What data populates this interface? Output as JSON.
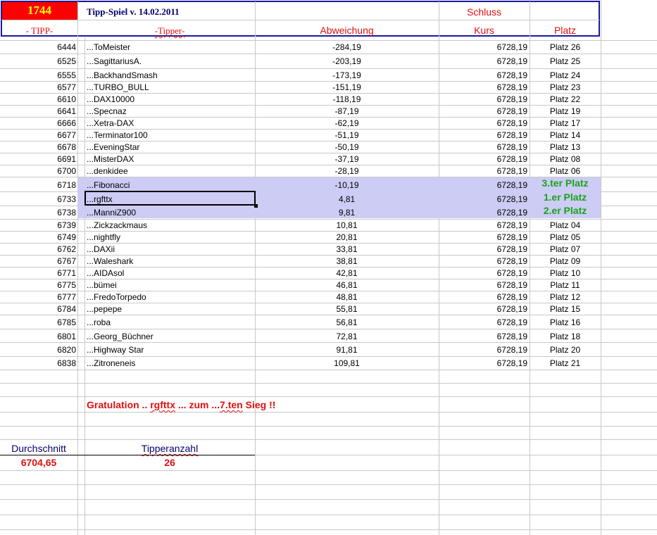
{
  "header": {
    "tipp_value": "1744",
    "title": "Tipp-Spiel v. 14.02.2011",
    "schluss": "Schluss",
    "col_tipp": "- TIPP-",
    "col_tipper": "-Tipper-",
    "col_abweichung": "Abweichung",
    "col_kurs": "Kurs",
    "col_platz": "Platz"
  },
  "rows": [
    {
      "tipp": "6444",
      "name": "...ToMeister",
      "abw": "-284,19",
      "kurs": "6728,19",
      "platz": "Platz 26"
    },
    {
      "tipp": "6525",
      "name": "...SagittariusA.",
      "abw": "-203,19",
      "kurs": "6728,19",
      "platz": "Platz 25"
    },
    {
      "tipp": "6555",
      "name": "...BackhandSmash",
      "abw": "-173,19",
      "kurs": "6728,19",
      "platz": "Platz 24"
    },
    {
      "tipp": "6577",
      "name": "...TURBO_BULL",
      "abw": "-151,19",
      "kurs": "6728,19",
      "platz": "Platz 23"
    },
    {
      "tipp": "6610",
      "name": "...DAX10000",
      "abw": "-118,19",
      "kurs": "6728,19",
      "platz": "Platz 22"
    },
    {
      "tipp": "6641",
      "name": "...Specnaz",
      "abw": "-87,19",
      "kurs": "6728,19",
      "platz": "Platz 19"
    },
    {
      "tipp": "6666",
      "name": "...Xetra-DAX",
      "abw": "-62,19",
      "kurs": "6728,19",
      "platz": "Platz 17"
    },
    {
      "tipp": "6677",
      "name": "...Terminator100",
      "abw": "-51,19",
      "kurs": "6728,19",
      "platz": "Platz 14"
    },
    {
      "tipp": "6678",
      "name": "...EveningStar",
      "abw": "-50,19",
      "kurs": "6728,19",
      "platz": "Platz 13"
    },
    {
      "tipp": "6691",
      "name": "...MisterDAX",
      "abw": "-37,19",
      "kurs": "6728,19",
      "platz": "Platz 08"
    },
    {
      "tipp": "6700",
      "name": "...denkidee",
      "abw": "-28,19",
      "kurs": "6728,19",
      "platz": "Platz 06"
    },
    {
      "tipp": "6718",
      "name": "...Fibonacci",
      "abw": "-10,19",
      "kurs": "6728,19",
      "platz": "3.ter Platz",
      "highlight": true
    },
    {
      "tipp": "6733",
      "name": "...rgfttx",
      "abw": "4,81",
      "kurs": "6728,19",
      "platz": "1.er Platz",
      "highlight": true,
      "selected": true
    },
    {
      "tipp": "6738",
      "name": "...ManniZ900",
      "abw": "9,81",
      "kurs": "6728,19",
      "platz": "2.er Platz",
      "highlight": true
    },
    {
      "tipp": "6739",
      "name": "...Zickzackmaus",
      "abw": "10,81",
      "kurs": "6728,19",
      "platz": "Platz 04"
    },
    {
      "tipp": "6749",
      "name": "...nightfly",
      "abw": "20,81",
      "kurs": "6728,19",
      "platz": "Platz 05"
    },
    {
      "tipp": "6762",
      "name": "...DAXii",
      "abw": "33,81",
      "kurs": "6728,19",
      "platz": "Platz 07"
    },
    {
      "tipp": "6767",
      "name": "...Waleshark",
      "abw": "38,81",
      "kurs": "6728,19",
      "platz": "Platz 09"
    },
    {
      "tipp": "6771",
      "name": "...AIDAsol",
      "abw": "42,81",
      "kurs": "6728,19",
      "platz": "Platz 10"
    },
    {
      "tipp": "6775",
      "name": "...bümei",
      "abw": "46,81",
      "kurs": "6728,19",
      "platz": "Platz 11"
    },
    {
      "tipp": "6777",
      "name": "...FredoTorpedo",
      "abw": "48,81",
      "kurs": "6728,19",
      "platz": "Platz 12"
    },
    {
      "tipp": "6784",
      "name": "...pepepe",
      "abw": "55,81",
      "kurs": "6728,19",
      "platz": "Platz 15"
    },
    {
      "tipp": "6785",
      "name": "...roba",
      "abw": "56,81",
      "kurs": "6728,19",
      "platz": "Platz 16"
    },
    {
      "tipp": "6801",
      "name": "...Georg_Büchner",
      "abw": "72,81",
      "kurs": "6728,19",
      "platz": "Platz 18"
    },
    {
      "tipp": "6820",
      "name": "...Highway Star",
      "abw": "91,81",
      "kurs": "6728,19",
      "platz": "Platz 20"
    },
    {
      "tipp": "6838",
      "name": "...Zitroneneis",
      "abw": "109,81",
      "kurs": "6728,19",
      "platz": "Platz 21"
    }
  ],
  "congrats": {
    "prefix": "Gratulation .. ",
    "winner": "rgfttx",
    "middle": " ... zum ...",
    "ordinal": "7.ten",
    "suffix": " Sieg !!"
  },
  "summary": {
    "avg_label": "Durchschnitt",
    "avg_value": "6704,65",
    "count_label": "Tipperanzahl",
    "count_value": "26"
  },
  "colors": {
    "header_red_bg": "#ff0000",
    "header_yellow_text": "#ffff00",
    "highlight_bg": "#ccccf5",
    "green_text": "#1aa31a",
    "red_text": "#e01010",
    "navy_text": "#00006e"
  }
}
